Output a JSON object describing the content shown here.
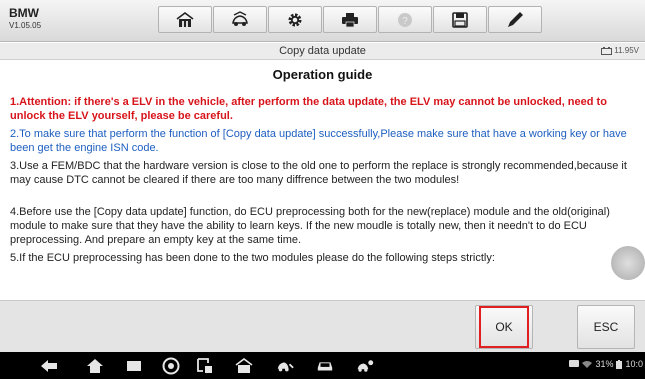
{
  "app": {
    "name": "BMW",
    "version": "V1.05.05"
  },
  "toolbar": {
    "buttons": [
      {
        "icon": "home-icon"
      },
      {
        "icon": "car-lift-icon"
      },
      {
        "icon": "settings-gear-icon"
      },
      {
        "icon": "printer-icon"
      },
      {
        "icon": "help-icon"
      },
      {
        "icon": "save-icon"
      },
      {
        "icon": "edit-pen-icon"
      }
    ]
  },
  "screen": {
    "title": "Copy data update",
    "voltage": "11.95V"
  },
  "guide": {
    "heading": "Operation guide",
    "paragraphs": [
      "1.Attention: if there's a ELV in the vehicle, after perform the data update, the ELV may cannot be unlocked, need to unlock the ELV yourself, please be careful.",
      "2.To make sure that perform the function of [Copy data update] successfully,Please make sure that have a working key or have been get the engine ISN code.",
      "3.Use a FEM/BDC that the hardware version is close to the old one to perform the replace is strongly recommended,because it may cause DTC cannot be cleared if there are too many diffrence between the two modules!",
      "4.Before use the [Copy data update] function, do ECU preprocessing both for the new(replace) module and the old(original) module to make sure that they have the ability to learn keys. If the new moudle is totally new, then it needn't to do ECU preprocessing. And prepare an empty key at the same time.",
      "5.If the ECU preprocessing has been done to the two modules please do the following steps strictly:"
    ],
    "colors": {
      "warning": "#d8141b",
      "info": "#1d5fc0",
      "normal": "#222222"
    }
  },
  "actions": {
    "ok_label": "OK",
    "esc_label": "ESC",
    "highlight_color": "#e02020"
  },
  "statusbar": {
    "battery": "31%",
    "time": "10:0"
  }
}
